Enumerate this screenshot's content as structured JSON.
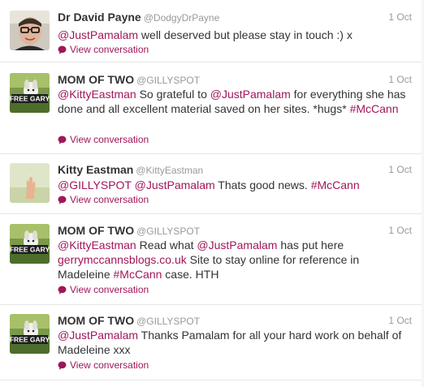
{
  "tweets": [
    {
      "name": "Dr David Payne",
      "handle": "@DodgyDrPayne",
      "time": "1 Oct",
      "avatar_icon": "man-with-glasses-avatar",
      "segments": [
        {
          "text": "@JustPamalam",
          "link": true
        },
        {
          "text": " well deserved but please stay in touch :) x",
          "link": false
        }
      ],
      "view_label": "View conversation"
    },
    {
      "name": "MOM OF TWO",
      "handle": "@GILLYSPOT",
      "time": "1 Oct",
      "avatar_icon": "free-gary-dog-avatar",
      "avatar_text": "FREE GARY",
      "segments": [
        {
          "text": "@KittyEastman",
          "link": true
        },
        {
          "text": " So grateful to ",
          "link": false
        },
        {
          "text": "@JustPamalam",
          "link": true
        },
        {
          "text": " for everything she has done and all excellent material saved on her sites. *hugs* ",
          "link": false
        },
        {
          "text": "#McCann",
          "link": true
        }
      ],
      "view_label": "View conversation"
    },
    {
      "name": "Kitty Eastman",
      "handle": "@KittyEastman",
      "time": "1 Oct",
      "avatar_icon": "hand-photo-avatar",
      "segments": [
        {
          "text": "@GILLYSPOT",
          "link": true
        },
        {
          "text": " ",
          "link": false
        },
        {
          "text": "@JustPamalam",
          "link": true
        },
        {
          "text": " Thats good news. ",
          "link": false
        },
        {
          "text": "#McCann",
          "link": true
        }
      ],
      "view_label": "View conversation"
    },
    {
      "name": "MOM OF TWO",
      "handle": "@GILLYSPOT",
      "time": "1 Oct",
      "avatar_icon": "free-gary-dog-avatar",
      "avatar_text": "FREE GARY",
      "segments": [
        {
          "text": "@KittyEastman",
          "link": true
        },
        {
          "text": " Read what ",
          "link": false
        },
        {
          "text": "@JustPamalam",
          "link": true
        },
        {
          "text": " has put here ",
          "link": false
        },
        {
          "text": "gerrymccannsblogs.co.uk",
          "link": true
        },
        {
          "text": " Site to stay online for reference in Madeleine ",
          "link": false
        },
        {
          "text": "#McCann",
          "link": true
        },
        {
          "text": " case. HTH",
          "link": false
        }
      ],
      "view_label": "View conversation"
    },
    {
      "name": "MOM OF TWO",
      "handle": "@GILLYSPOT",
      "time": "1 Oct",
      "avatar_icon": "free-gary-dog-avatar",
      "avatar_text": "FREE GARY",
      "segments": [
        {
          "text": "@JustPamalam",
          "link": true
        },
        {
          "text": " Thanks Pamalam for all your hard work on behalf of Madeleine xxx",
          "link": false
        }
      ],
      "view_label": "View conversation"
    }
  ],
  "colors": {
    "link": "#a0165a",
    "name": "#333333",
    "meta": "#999999",
    "divider": "#e6e6e6"
  }
}
